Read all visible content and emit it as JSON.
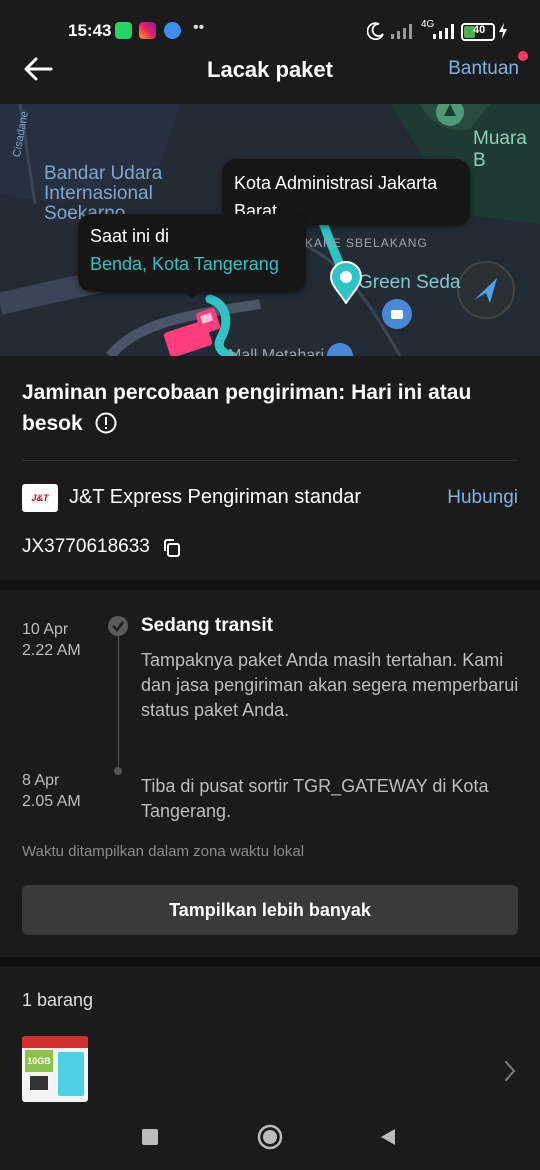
{
  "status_bar": {
    "time": "15:43",
    "network": "4G",
    "battery": "40"
  },
  "header": {
    "title": "Lacak paket",
    "help_label": "Bantuan"
  },
  "map": {
    "labels": {
      "airport": "Bandar Udara Internasional Soekarno",
      "road": "Cisadane",
      "muara": "Muara B",
      "belakang": "KARE SBELAKANG",
      "green": "Green Seda",
      "mall": "Mall Metahari"
    },
    "region_tooltip": "Kota Administrasi Jakarta Barat",
    "current_label": "Saat ini di",
    "current_location": "Benda, Kota Tangerang"
  },
  "guarantee": {
    "text": "Jaminan percobaan pengiriman: Hari ini atau besok"
  },
  "courier": {
    "logo_text": "J&T",
    "name": "J&T Express Pengiriman standar",
    "contact_label": "Hubungi",
    "tracking_number": "JX3770618633"
  },
  "timeline": [
    {
      "date": "10 Apr",
      "time": "2.22 AM",
      "status": "Sedang transit",
      "detail": "Tampaknya paket Anda masih tertahan. Kami dan jasa pengiriman akan segera memperbarui status paket Anda."
    },
    {
      "date": "8 Apr",
      "time": "2.05 AM",
      "status": "",
      "detail": "Tiba di pusat sortir TGR_GATEWAY di Kota Tangerang."
    }
  ],
  "timezone_note": "Waktu ditampilkan dalam zona waktu lokal",
  "show_more_label": "Tampilkan lebih banyak",
  "items": {
    "count_label": "1 barang",
    "thumb_text": "10GB"
  },
  "colors": {
    "accent_teal": "#2ec4c4",
    "link_blue": "#7fb3e6",
    "truck_pink": "#ff3d7f"
  }
}
